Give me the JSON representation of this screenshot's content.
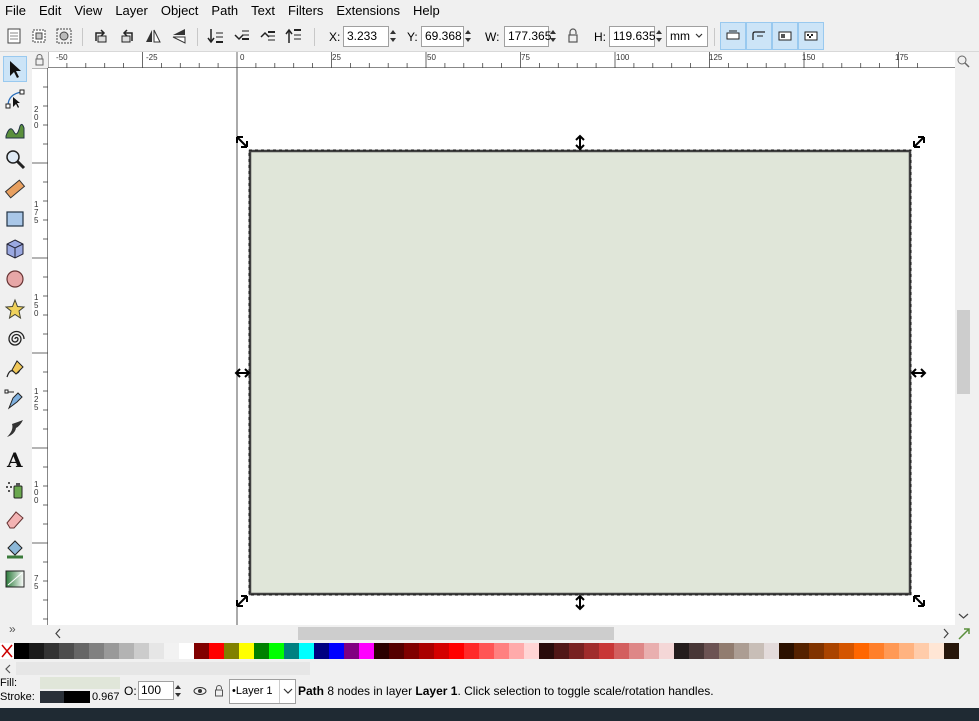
{
  "menu": [
    "File",
    "Edit",
    "View",
    "Layer",
    "Object",
    "Path",
    "Text",
    "Filters",
    "Extensions",
    "Help"
  ],
  "toolbar": {
    "x_label": "X:",
    "x_value": "3.233",
    "y_label": "Y:",
    "y_value": "69.368",
    "w_label": "W:",
    "w_value": "177.365",
    "h_label": "H:",
    "h_value": "119.635",
    "unit": "mm"
  },
  "ruler": {
    "h_ticks": [
      "-50",
      "-25",
      "0",
      "25",
      "50",
      "75",
      "100",
      "125",
      "150",
      "175"
    ],
    "v_ticks": [
      "2\n0\n0",
      "1\n7\n5",
      "1\n5\n0",
      "1\n2\n5",
      "1\n0\n0",
      "7\n5"
    ]
  },
  "palette_colors": [
    "#000000",
    "#1a1a1a",
    "#333333",
    "#4d4d4d",
    "#666666",
    "#808080",
    "#999999",
    "#b3b3b3",
    "#cccccc",
    "#e6e6e6",
    "#f2f2f2",
    "#ffffff",
    "#800000",
    "#ff0000",
    "#808000",
    "#ffff00",
    "#008000",
    "#00ff00",
    "#008080",
    "#00ffff",
    "#000080",
    "#0000ff",
    "#800080",
    "#ff00ff",
    "#2b0000",
    "#550000",
    "#800000",
    "#aa0000",
    "#d40000",
    "#ff0000",
    "#ff2a2a",
    "#ff5555",
    "#ff8080",
    "#ffaaaa",
    "#ffd5d5",
    "#280b0b",
    "#501616",
    "#782121",
    "#a02c2c",
    "#c83737",
    "#d35f5f",
    "#de8787",
    "#e9afaf",
    "#f4d7d7",
    "#241c1c",
    "#483737",
    "#6c5353",
    "#917c6f",
    "#ac9d93",
    "#c8beb7",
    "#e3dbdb",
    "#2b1100",
    "#552200",
    "#803300",
    "#aa4400",
    "#d45500",
    "#ff6600",
    "#ff7f2a",
    "#ff9955",
    "#ffb380",
    "#ffccaa",
    "#ffe6d5",
    "#28170b"
  ],
  "status": {
    "fill_label": "Fill:",
    "stroke_label": "Stroke:",
    "stroke_width": "0.967",
    "opacity_label": "O:",
    "opacity_value": "100",
    "layer_name": "•Layer 1",
    "msg_path": "Path",
    "msg_mid": " 8 nodes in layer ",
    "msg_layer": "Layer 1",
    "msg_end": ". Click selection to toggle scale/rotation handles."
  },
  "colors": {
    "rect_fill": "#e0e6d9",
    "rect_stroke": "#404040",
    "accent": "#cce4f7"
  }
}
